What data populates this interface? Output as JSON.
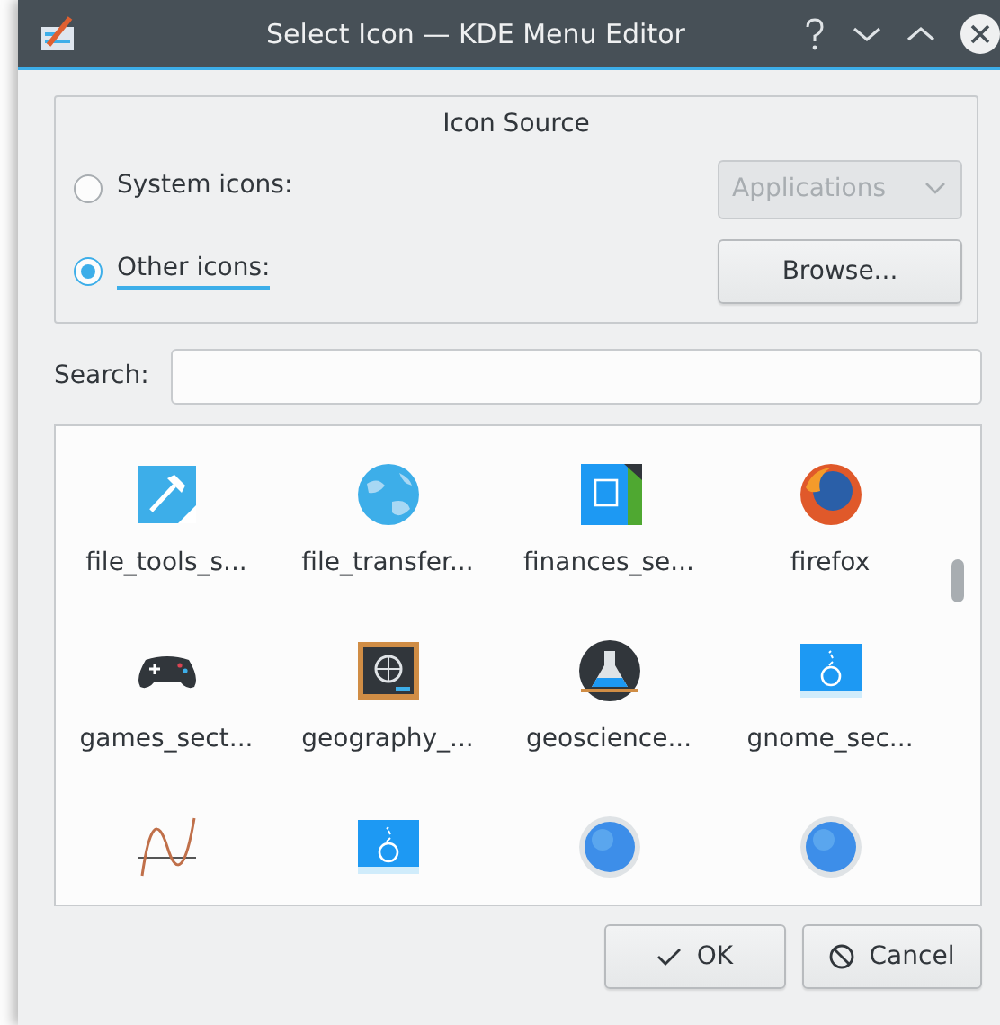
{
  "window": {
    "title": "Select Icon — KDE Menu Editor"
  },
  "icon_source": {
    "title": "Icon Source",
    "options": [
      {
        "label": "System icons:",
        "selected": false,
        "focused": false
      },
      {
        "label": "Other icons:",
        "selected": true,
        "focused": true
      }
    ],
    "dropdown": {
      "value": "Applications",
      "disabled": true
    },
    "browse_button": "Browse..."
  },
  "search": {
    "label": "Search:"
  },
  "icons": [
    {
      "label": "file_tools_s...",
      "kind": "hammer"
    },
    {
      "label": "file_transfer...",
      "kind": "globe"
    },
    {
      "label": "finances_se...",
      "kind": "document"
    },
    {
      "label": "firefox",
      "kind": "fox"
    },
    {
      "label": "games_sect...",
      "kind": "gamepad"
    },
    {
      "label": "geography_...",
      "kind": "chalkboard"
    },
    {
      "label": "geoscience...",
      "kind": "flask"
    },
    {
      "label": "gnome_sec...",
      "kind": "screen"
    },
    {
      "kind": "wave"
    },
    {
      "kind": "screen"
    },
    {
      "kind": "sphere"
    },
    {
      "kind": "sphere"
    }
  ],
  "buttons": [
    {
      "label": "OK",
      "kind": "ok"
    },
    {
      "label": "Cancel",
      "kind": "cancel"
    }
  ]
}
